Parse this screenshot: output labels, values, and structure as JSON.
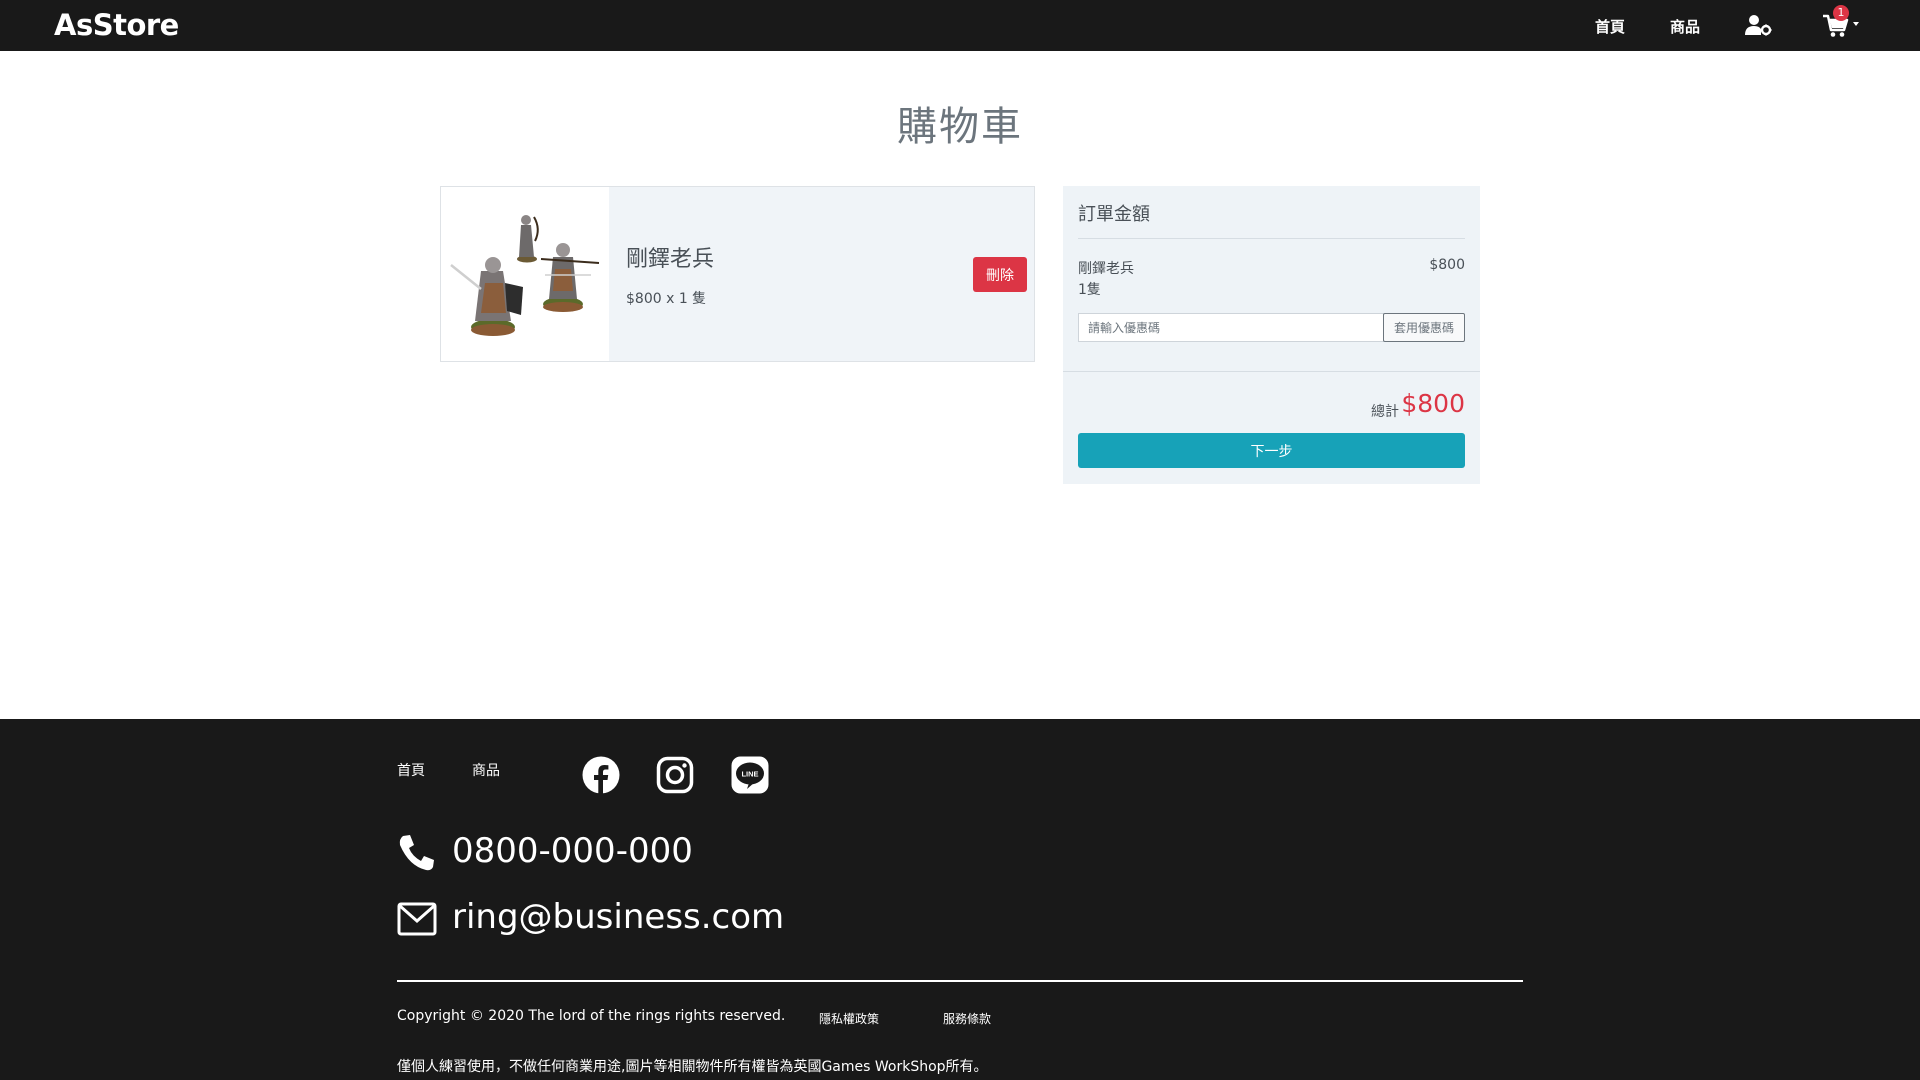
{
  "navbar": {
    "brand": "AsStore",
    "home": "首頁",
    "products": "商品",
    "user_icon": "user-settings-icon",
    "cart_icon": "cart-icon",
    "cart_count": "1"
  },
  "page": {
    "title": "購物車"
  },
  "cart": {
    "items": [
      {
        "name": "剛鐸老兵",
        "qty_text": "$800 x 1 隻",
        "delete_label": "刪除",
        "image": "soldier-figurines-image"
      }
    ]
  },
  "summary": {
    "title": "訂單金額",
    "item_name": "剛鐸老兵",
    "item_qty": "1隻",
    "item_price": "$800",
    "coupon_placeholder": "請輸入優惠碼",
    "coupon_button": "套用優惠碼",
    "total_label": "總計",
    "total_value": "$800",
    "next_button": "下一步"
  },
  "footer": {
    "home": "首頁",
    "products": "商品",
    "social_icons": [
      "facebook-icon",
      "instagram-icon",
      "line-icon"
    ],
    "phone": "0800-000-000",
    "email": "ring@business.com",
    "copyright": "Copyright © 2020 The lord of the rings rights reserved.",
    "privacy": "隱私權政策",
    "terms": "服務條款",
    "disclaimer": "僅個人練習使用，不做任何商業用途,圖片等相關物件所有權皆為英國Games WorkShop所有。"
  },
  "colors": {
    "nav_bg": "#191919",
    "danger": "#dc3545",
    "info": "#17a2b8",
    "summary_bg": "#eef3f7",
    "title_gray": "#6c757d"
  }
}
